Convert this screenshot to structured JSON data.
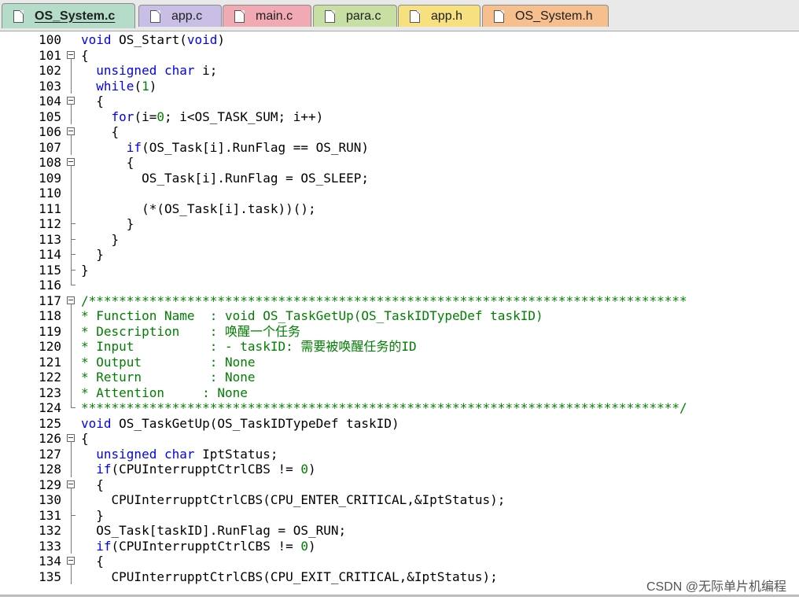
{
  "tabs": [
    {
      "label": "OS_System.c",
      "active": true,
      "color": "#b4dcc8",
      "icon": "file-icon"
    },
    {
      "label": "app.c",
      "active": false,
      "color": "#c9bfe6",
      "icon": "file-icon"
    },
    {
      "label": "main.c",
      "active": false,
      "color": "#f1a9b4",
      "icon": "file-icon"
    },
    {
      "label": "para.c",
      "active": false,
      "color": "#c7dfa3",
      "icon": "file-icon"
    },
    {
      "label": "app.h",
      "active": false,
      "color": "#f7e07e",
      "icon": "file-icon"
    },
    {
      "label": "OS_System.h",
      "active": false,
      "color": "#f7bf8e",
      "icon": "file-icon"
    }
  ],
  "colors": {
    "keyword": "#0000ff",
    "number": "#008000",
    "comment": "#008000",
    "text": "#000000"
  },
  "lines": [
    {
      "num": "100",
      "fold": "none",
      "segs": [
        [
          "kw",
          "void"
        ],
        [
          "t",
          " OS_Start("
        ],
        [
          "kw",
          "void"
        ],
        [
          "t",
          ")"
        ]
      ]
    },
    {
      "num": "101",
      "fold": "open",
      "segs": [
        [
          "t",
          "{"
        ]
      ]
    },
    {
      "num": "102",
      "fold": "line",
      "segs": [
        [
          "t",
          "  "
        ],
        [
          "kw",
          "unsigned char"
        ],
        [
          "t",
          " i;"
        ]
      ]
    },
    {
      "num": "103",
      "fold": "line",
      "segs": [
        [
          "t",
          "  "
        ],
        [
          "kw",
          "while"
        ],
        [
          "t",
          "("
        ],
        [
          "num",
          "1"
        ],
        [
          "t",
          ")"
        ]
      ]
    },
    {
      "num": "104",
      "fold": "open",
      "segs": [
        [
          "t",
          "  {"
        ]
      ]
    },
    {
      "num": "105",
      "fold": "line",
      "segs": [
        [
          "t",
          "    "
        ],
        [
          "kw",
          "for"
        ],
        [
          "t",
          "(i="
        ],
        [
          "num",
          "0"
        ],
        [
          "t",
          "; i<OS_TASK_SUM; i++)"
        ]
      ]
    },
    {
      "num": "106",
      "fold": "open",
      "segs": [
        [
          "t",
          "    {"
        ]
      ]
    },
    {
      "num": "107",
      "fold": "line",
      "segs": [
        [
          "t",
          "      "
        ],
        [
          "kw",
          "if"
        ],
        [
          "t",
          "(OS_Task[i].RunFlag == OS_RUN)"
        ]
      ]
    },
    {
      "num": "108",
      "fold": "open",
      "segs": [
        [
          "t",
          "      {"
        ]
      ]
    },
    {
      "num": "109",
      "fold": "line",
      "segs": [
        [
          "t",
          "        OS_Task[i].RunFlag = OS_SLEEP;"
        ]
      ]
    },
    {
      "num": "110",
      "fold": "line",
      "segs": [
        [
          "t",
          ""
        ]
      ]
    },
    {
      "num": "111",
      "fold": "line",
      "segs": [
        [
          "t",
          "        (*(OS_Task[i].task))();"
        ]
      ]
    },
    {
      "num": "112",
      "fold": "end",
      "segs": [
        [
          "t",
          "      }"
        ]
      ]
    },
    {
      "num": "113",
      "fold": "end",
      "segs": [
        [
          "t",
          "    }"
        ]
      ]
    },
    {
      "num": "114",
      "fold": "end",
      "segs": [
        [
          "t",
          "  }"
        ]
      ]
    },
    {
      "num": "115",
      "fold": "end",
      "segs": [
        [
          "t",
          "}"
        ]
      ]
    },
    {
      "num": "116",
      "fold": "endlast",
      "segs": [
        [
          "t",
          ""
        ]
      ]
    },
    {
      "num": "117",
      "fold": "open",
      "segs": [
        [
          "cm",
          "/*******************************************************************************"
        ]
      ]
    },
    {
      "num": "118",
      "fold": "line",
      "segs": [
        [
          "cm",
          "* Function Name  : void OS_TaskGetUp(OS_TaskIDTypeDef taskID)"
        ]
      ]
    },
    {
      "num": "119",
      "fold": "line",
      "segs": [
        [
          "cm",
          "* Description    : 唤醒一个任务"
        ]
      ]
    },
    {
      "num": "120",
      "fold": "line",
      "segs": [
        [
          "cm",
          "* Input          : - taskID: 需要被唤醒任务的ID"
        ]
      ]
    },
    {
      "num": "121",
      "fold": "line",
      "segs": [
        [
          "cm",
          "* Output         : None"
        ]
      ]
    },
    {
      "num": "122",
      "fold": "line",
      "segs": [
        [
          "cm",
          "* Return         : None"
        ]
      ]
    },
    {
      "num": "123",
      "fold": "line",
      "segs": [
        [
          "cm",
          "* Attention     : None"
        ]
      ]
    },
    {
      "num": "124",
      "fold": "endlast",
      "segs": [
        [
          "cm",
          "*******************************************************************************/"
        ]
      ]
    },
    {
      "num": "125",
      "fold": "none",
      "segs": [
        [
          "kw",
          "void"
        ],
        [
          "t",
          " OS_TaskGetUp(OS_TaskIDTypeDef taskID)"
        ]
      ]
    },
    {
      "num": "126",
      "fold": "open",
      "segs": [
        [
          "t",
          "{"
        ]
      ]
    },
    {
      "num": "127",
      "fold": "line",
      "segs": [
        [
          "t",
          "  "
        ],
        [
          "kw",
          "unsigned char"
        ],
        [
          "t",
          " IptStatus;"
        ]
      ]
    },
    {
      "num": "128",
      "fold": "line",
      "segs": [
        [
          "t",
          "  "
        ],
        [
          "kw",
          "if"
        ],
        [
          "t",
          "(CPUInterrupptCtrlCBS != "
        ],
        [
          "num",
          "0"
        ],
        [
          "t",
          ")"
        ]
      ]
    },
    {
      "num": "129",
      "fold": "open",
      "segs": [
        [
          "t",
          "  {"
        ]
      ]
    },
    {
      "num": "130",
      "fold": "line",
      "segs": [
        [
          "t",
          "    CPUInterrupptCtrlCBS(CPU_ENTER_CRITICAL,&IptStatus);"
        ]
      ]
    },
    {
      "num": "131",
      "fold": "end",
      "segs": [
        [
          "t",
          "  }"
        ]
      ]
    },
    {
      "num": "132",
      "fold": "line",
      "segs": [
        [
          "t",
          "  OS_Task[taskID].RunFlag = OS_RUN;"
        ]
      ]
    },
    {
      "num": "133",
      "fold": "line",
      "segs": [
        [
          "t",
          "  "
        ],
        [
          "kw",
          "if"
        ],
        [
          "t",
          "(CPUInterrupptCtrlCBS != "
        ],
        [
          "num",
          "0"
        ],
        [
          "t",
          ")"
        ]
      ]
    },
    {
      "num": "134",
      "fold": "open",
      "segs": [
        [
          "t",
          "  {"
        ]
      ]
    },
    {
      "num": "135",
      "fold": "line",
      "segs": [
        [
          "t",
          "    CPUInterrupptCtrlCBS(CPU_EXIT_CRITICAL,&IptStatus);"
        ]
      ]
    }
  ],
  "watermark": "CSDN @无际单片机编程"
}
